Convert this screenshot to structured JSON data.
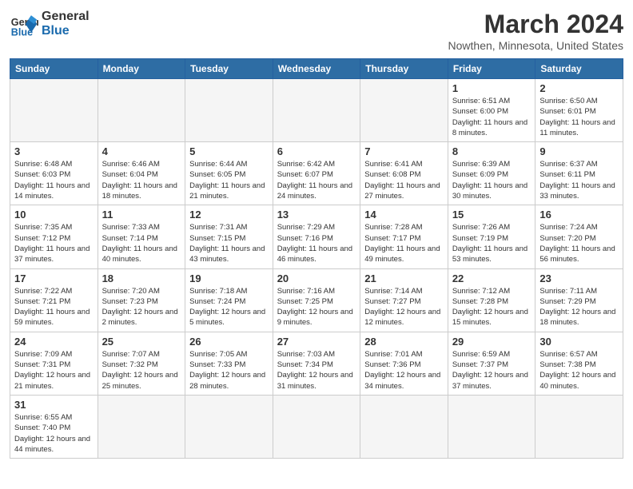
{
  "header": {
    "logo_general": "General",
    "logo_blue": "Blue",
    "title": "March 2024",
    "subtitle": "Nowthen, Minnesota, United States"
  },
  "weekdays": [
    "Sunday",
    "Monday",
    "Tuesday",
    "Wednesday",
    "Thursday",
    "Friday",
    "Saturday"
  ],
  "weeks": [
    [
      {
        "day": "",
        "info": ""
      },
      {
        "day": "",
        "info": ""
      },
      {
        "day": "",
        "info": ""
      },
      {
        "day": "",
        "info": ""
      },
      {
        "day": "",
        "info": ""
      },
      {
        "day": "1",
        "info": "Sunrise: 6:51 AM\nSunset: 6:00 PM\nDaylight: 11 hours\nand 8 minutes."
      },
      {
        "day": "2",
        "info": "Sunrise: 6:50 AM\nSunset: 6:01 PM\nDaylight: 11 hours\nand 11 minutes."
      }
    ],
    [
      {
        "day": "3",
        "info": "Sunrise: 6:48 AM\nSunset: 6:03 PM\nDaylight: 11 hours\nand 14 minutes."
      },
      {
        "day": "4",
        "info": "Sunrise: 6:46 AM\nSunset: 6:04 PM\nDaylight: 11 hours\nand 18 minutes."
      },
      {
        "day": "5",
        "info": "Sunrise: 6:44 AM\nSunset: 6:05 PM\nDaylight: 11 hours\nand 21 minutes."
      },
      {
        "day": "6",
        "info": "Sunrise: 6:42 AM\nSunset: 6:07 PM\nDaylight: 11 hours\nand 24 minutes."
      },
      {
        "day": "7",
        "info": "Sunrise: 6:41 AM\nSunset: 6:08 PM\nDaylight: 11 hours\nand 27 minutes."
      },
      {
        "day": "8",
        "info": "Sunrise: 6:39 AM\nSunset: 6:09 PM\nDaylight: 11 hours\nand 30 minutes."
      },
      {
        "day": "9",
        "info": "Sunrise: 6:37 AM\nSunset: 6:11 PM\nDaylight: 11 hours\nand 33 minutes."
      }
    ],
    [
      {
        "day": "10",
        "info": "Sunrise: 7:35 AM\nSunset: 7:12 PM\nDaylight: 11 hours\nand 37 minutes."
      },
      {
        "day": "11",
        "info": "Sunrise: 7:33 AM\nSunset: 7:14 PM\nDaylight: 11 hours\nand 40 minutes."
      },
      {
        "day": "12",
        "info": "Sunrise: 7:31 AM\nSunset: 7:15 PM\nDaylight: 11 hours\nand 43 minutes."
      },
      {
        "day": "13",
        "info": "Sunrise: 7:29 AM\nSunset: 7:16 PM\nDaylight: 11 hours\nand 46 minutes."
      },
      {
        "day": "14",
        "info": "Sunrise: 7:28 AM\nSunset: 7:17 PM\nDaylight: 11 hours\nand 49 minutes."
      },
      {
        "day": "15",
        "info": "Sunrise: 7:26 AM\nSunset: 7:19 PM\nDaylight: 11 hours\nand 53 minutes."
      },
      {
        "day": "16",
        "info": "Sunrise: 7:24 AM\nSunset: 7:20 PM\nDaylight: 11 hours\nand 56 minutes."
      }
    ],
    [
      {
        "day": "17",
        "info": "Sunrise: 7:22 AM\nSunset: 7:21 PM\nDaylight: 11 hours\nand 59 minutes."
      },
      {
        "day": "18",
        "info": "Sunrise: 7:20 AM\nSunset: 7:23 PM\nDaylight: 12 hours\nand 2 minutes."
      },
      {
        "day": "19",
        "info": "Sunrise: 7:18 AM\nSunset: 7:24 PM\nDaylight: 12 hours\nand 5 minutes."
      },
      {
        "day": "20",
        "info": "Sunrise: 7:16 AM\nSunset: 7:25 PM\nDaylight: 12 hours\nand 9 minutes."
      },
      {
        "day": "21",
        "info": "Sunrise: 7:14 AM\nSunset: 7:27 PM\nDaylight: 12 hours\nand 12 minutes."
      },
      {
        "day": "22",
        "info": "Sunrise: 7:12 AM\nSunset: 7:28 PM\nDaylight: 12 hours\nand 15 minutes."
      },
      {
        "day": "23",
        "info": "Sunrise: 7:11 AM\nSunset: 7:29 PM\nDaylight: 12 hours\nand 18 minutes."
      }
    ],
    [
      {
        "day": "24",
        "info": "Sunrise: 7:09 AM\nSunset: 7:31 PM\nDaylight: 12 hours\nand 21 minutes."
      },
      {
        "day": "25",
        "info": "Sunrise: 7:07 AM\nSunset: 7:32 PM\nDaylight: 12 hours\nand 25 minutes."
      },
      {
        "day": "26",
        "info": "Sunrise: 7:05 AM\nSunset: 7:33 PM\nDaylight: 12 hours\nand 28 minutes."
      },
      {
        "day": "27",
        "info": "Sunrise: 7:03 AM\nSunset: 7:34 PM\nDaylight: 12 hours\nand 31 minutes."
      },
      {
        "day": "28",
        "info": "Sunrise: 7:01 AM\nSunset: 7:36 PM\nDaylight: 12 hours\nand 34 minutes."
      },
      {
        "day": "29",
        "info": "Sunrise: 6:59 AM\nSunset: 7:37 PM\nDaylight: 12 hours\nand 37 minutes."
      },
      {
        "day": "30",
        "info": "Sunrise: 6:57 AM\nSunset: 7:38 PM\nDaylight: 12 hours\nand 40 minutes."
      }
    ],
    [
      {
        "day": "31",
        "info": "Sunrise: 6:55 AM\nSunset: 7:40 PM\nDaylight: 12 hours\nand 44 minutes."
      },
      {
        "day": "",
        "info": ""
      },
      {
        "day": "",
        "info": ""
      },
      {
        "day": "",
        "info": ""
      },
      {
        "day": "",
        "info": ""
      },
      {
        "day": "",
        "info": ""
      },
      {
        "day": "",
        "info": ""
      }
    ]
  ]
}
